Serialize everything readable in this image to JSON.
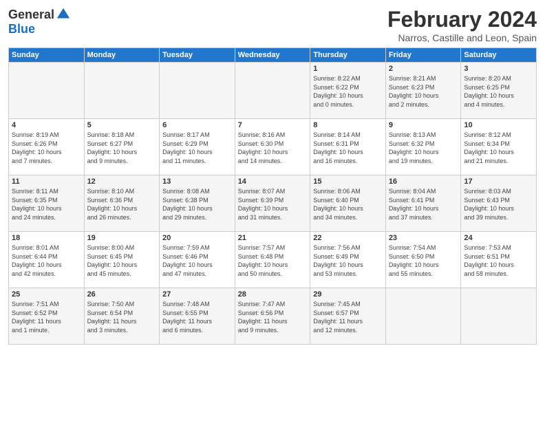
{
  "header": {
    "logo_general": "General",
    "logo_blue": "Blue",
    "month_title": "February 2024",
    "location": "Narros, Castille and Leon, Spain"
  },
  "days_of_week": [
    "Sunday",
    "Monday",
    "Tuesday",
    "Wednesday",
    "Thursday",
    "Friday",
    "Saturday"
  ],
  "weeks": [
    [
      {
        "day": "",
        "info": ""
      },
      {
        "day": "",
        "info": ""
      },
      {
        "day": "",
        "info": ""
      },
      {
        "day": "",
        "info": ""
      },
      {
        "day": "1",
        "info": "Sunrise: 8:22 AM\nSunset: 6:22 PM\nDaylight: 10 hours\nand 0 minutes."
      },
      {
        "day": "2",
        "info": "Sunrise: 8:21 AM\nSunset: 6:23 PM\nDaylight: 10 hours\nand 2 minutes."
      },
      {
        "day": "3",
        "info": "Sunrise: 8:20 AM\nSunset: 6:25 PM\nDaylight: 10 hours\nand 4 minutes."
      }
    ],
    [
      {
        "day": "4",
        "info": "Sunrise: 8:19 AM\nSunset: 6:26 PM\nDaylight: 10 hours\nand 7 minutes."
      },
      {
        "day": "5",
        "info": "Sunrise: 8:18 AM\nSunset: 6:27 PM\nDaylight: 10 hours\nand 9 minutes."
      },
      {
        "day": "6",
        "info": "Sunrise: 8:17 AM\nSunset: 6:29 PM\nDaylight: 10 hours\nand 11 minutes."
      },
      {
        "day": "7",
        "info": "Sunrise: 8:16 AM\nSunset: 6:30 PM\nDaylight: 10 hours\nand 14 minutes."
      },
      {
        "day": "8",
        "info": "Sunrise: 8:14 AM\nSunset: 6:31 PM\nDaylight: 10 hours\nand 16 minutes."
      },
      {
        "day": "9",
        "info": "Sunrise: 8:13 AM\nSunset: 6:32 PM\nDaylight: 10 hours\nand 19 minutes."
      },
      {
        "day": "10",
        "info": "Sunrise: 8:12 AM\nSunset: 6:34 PM\nDaylight: 10 hours\nand 21 minutes."
      }
    ],
    [
      {
        "day": "11",
        "info": "Sunrise: 8:11 AM\nSunset: 6:35 PM\nDaylight: 10 hours\nand 24 minutes."
      },
      {
        "day": "12",
        "info": "Sunrise: 8:10 AM\nSunset: 6:36 PM\nDaylight: 10 hours\nand 26 minutes."
      },
      {
        "day": "13",
        "info": "Sunrise: 8:08 AM\nSunset: 6:38 PM\nDaylight: 10 hours\nand 29 minutes."
      },
      {
        "day": "14",
        "info": "Sunrise: 8:07 AM\nSunset: 6:39 PM\nDaylight: 10 hours\nand 31 minutes."
      },
      {
        "day": "15",
        "info": "Sunrise: 8:06 AM\nSunset: 6:40 PM\nDaylight: 10 hours\nand 34 minutes."
      },
      {
        "day": "16",
        "info": "Sunrise: 8:04 AM\nSunset: 6:41 PM\nDaylight: 10 hours\nand 37 minutes."
      },
      {
        "day": "17",
        "info": "Sunrise: 8:03 AM\nSunset: 6:43 PM\nDaylight: 10 hours\nand 39 minutes."
      }
    ],
    [
      {
        "day": "18",
        "info": "Sunrise: 8:01 AM\nSunset: 6:44 PM\nDaylight: 10 hours\nand 42 minutes."
      },
      {
        "day": "19",
        "info": "Sunrise: 8:00 AM\nSunset: 6:45 PM\nDaylight: 10 hours\nand 45 minutes."
      },
      {
        "day": "20",
        "info": "Sunrise: 7:59 AM\nSunset: 6:46 PM\nDaylight: 10 hours\nand 47 minutes."
      },
      {
        "day": "21",
        "info": "Sunrise: 7:57 AM\nSunset: 6:48 PM\nDaylight: 10 hours\nand 50 minutes."
      },
      {
        "day": "22",
        "info": "Sunrise: 7:56 AM\nSunset: 6:49 PM\nDaylight: 10 hours\nand 53 minutes."
      },
      {
        "day": "23",
        "info": "Sunrise: 7:54 AM\nSunset: 6:50 PM\nDaylight: 10 hours\nand 55 minutes."
      },
      {
        "day": "24",
        "info": "Sunrise: 7:53 AM\nSunset: 6:51 PM\nDaylight: 10 hours\nand 58 minutes."
      }
    ],
    [
      {
        "day": "25",
        "info": "Sunrise: 7:51 AM\nSunset: 6:52 PM\nDaylight: 11 hours\nand 1 minute."
      },
      {
        "day": "26",
        "info": "Sunrise: 7:50 AM\nSunset: 6:54 PM\nDaylight: 11 hours\nand 3 minutes."
      },
      {
        "day": "27",
        "info": "Sunrise: 7:48 AM\nSunset: 6:55 PM\nDaylight: 11 hours\nand 6 minutes."
      },
      {
        "day": "28",
        "info": "Sunrise: 7:47 AM\nSunset: 6:56 PM\nDaylight: 11 hours\nand 9 minutes."
      },
      {
        "day": "29",
        "info": "Sunrise: 7:45 AM\nSunset: 6:57 PM\nDaylight: 11 hours\nand 12 minutes."
      },
      {
        "day": "",
        "info": ""
      },
      {
        "day": "",
        "info": ""
      }
    ]
  ]
}
